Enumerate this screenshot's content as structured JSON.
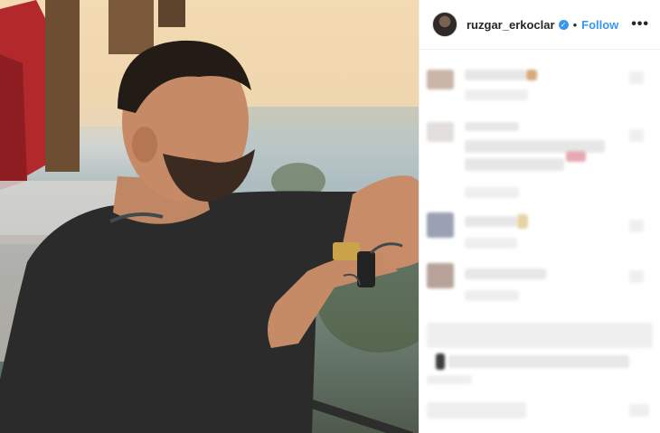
{
  "post": {
    "username": "ruzgar_erkoclar",
    "separator": "•",
    "follow_label": "Follow",
    "more_label": "•••",
    "verified_glyph": "✓"
  },
  "colors": {
    "accent": "#3897f0",
    "text": "#262626",
    "divider": "#efefef"
  },
  "icons": {
    "verified": "verified-badge-icon",
    "more": "more-options-icon"
  }
}
